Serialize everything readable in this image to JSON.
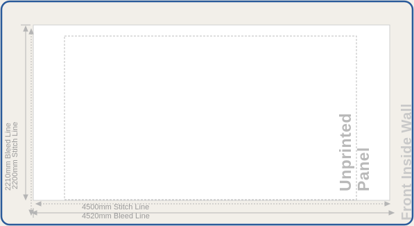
{
  "dimensions": {
    "stitch_width_label": "4500mm Stitch Line",
    "bleed_width_label": "4520mm Bleed Line",
    "bleed_height_label": "2210mm Bleed Line",
    "stitch_height_label": "2200mm Stitch Line"
  },
  "panel": {
    "line1": "Unprinted",
    "line2": "Panel"
  },
  "wall": {
    "title": "Front Inside Wall"
  },
  "colors": {
    "frame_border": "#2a5a9a",
    "background": "#f2efe9",
    "panel_fill": "#ffffff",
    "guide_line": "#b5b5b5"
  }
}
